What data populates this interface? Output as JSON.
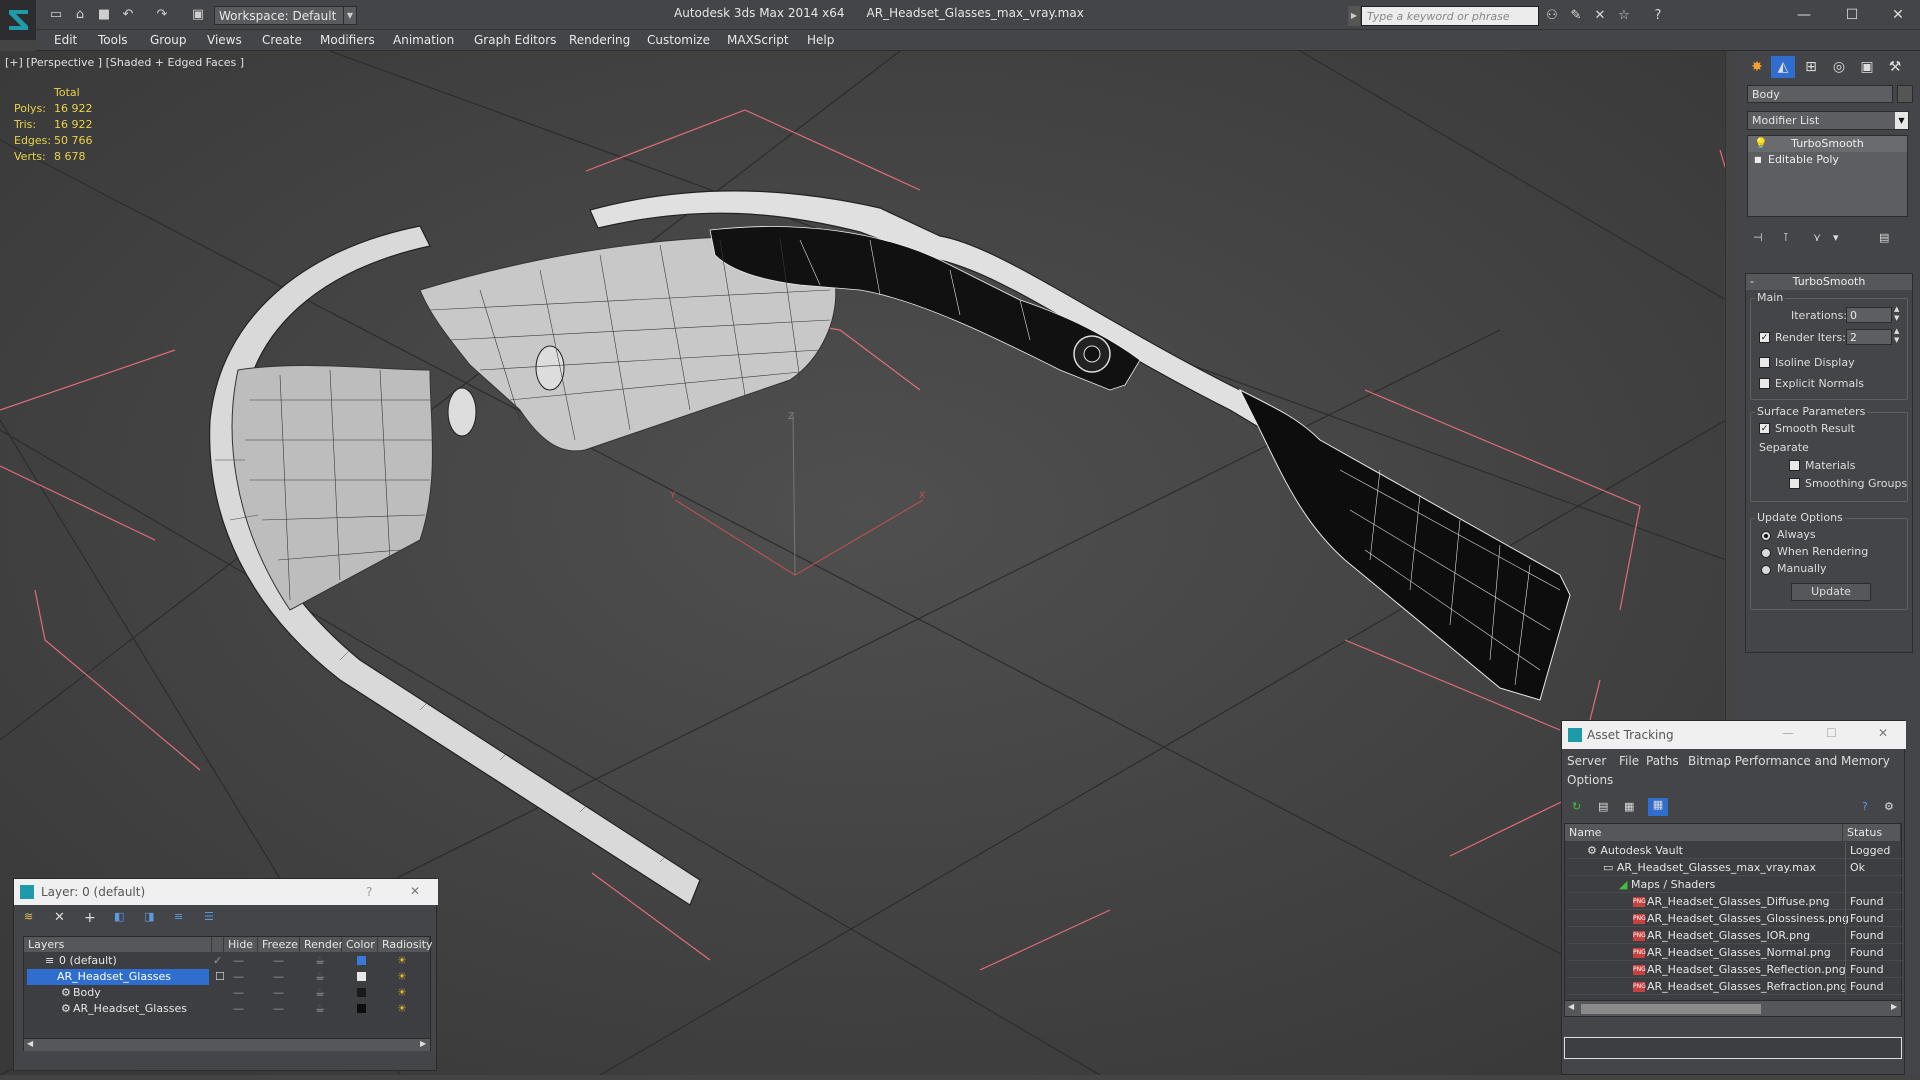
{
  "app": {
    "title": "Autodesk 3ds Max 2014 x64",
    "file": "AR_Headset_Glasses_max_vray.max",
    "workspace": "Workspace: Default",
    "search_placeholder": "Type a keyword or phrase"
  },
  "menu": [
    "Edit",
    "Tools",
    "Group",
    "Views",
    "Create",
    "Modifiers",
    "Animation",
    "Graph Editors",
    "Rendering",
    "Customize",
    "MAXScript",
    "Help"
  ],
  "viewport": {
    "label": "[+] [Perspective ] [Shaded + Edged Faces ]",
    "stats": {
      "header": "Total",
      "polys_label": "Polys:",
      "polys": "16 922",
      "tris_label": "Tris:",
      "tris": "16 922",
      "edges_label": "Edges:",
      "edges": "50 766",
      "verts_label": "Verts:",
      "verts": "8 678"
    }
  },
  "command_panel": {
    "object_name": "Body",
    "modifier_list": "Modifier List",
    "stack": [
      "TurboSmooth",
      "Editable Poly"
    ],
    "rollout_title": "TurboSmooth",
    "main_group": "Main",
    "iterations_label": "Iterations:",
    "iterations": "0",
    "render_iters_label": "Render Iters:",
    "render_iters": "2",
    "isoline": "Isoline Display",
    "explicit_normals": "Explicit Normals",
    "surface_group": "Surface Parameters",
    "smooth_result": "Smooth Result",
    "separate": "Separate",
    "materials": "Materials",
    "smoothing_groups": "Smoothing Groups",
    "update_group": "Update Options",
    "always": "Always",
    "when_rendering": "When Rendering",
    "manually": "Manually",
    "update_button": "Update"
  },
  "layer_dialog": {
    "title": "Layer: 0 (default)",
    "help": "?",
    "columns": [
      "Layers",
      "Hide",
      "Freeze",
      "Render",
      "Color",
      "Radiosity"
    ],
    "rows": [
      {
        "name": "0 (default)",
        "color": "#3a78d6"
      },
      {
        "name": "AR_Headset_Glasses",
        "color": "#e8e8e8"
      },
      {
        "name": "Body",
        "color": "#1a1a1a"
      },
      {
        "name": "AR_Headset_Glasses",
        "color": "#0d0d0d"
      }
    ]
  },
  "asset_tracking": {
    "title": "Asset Tracking",
    "menu": [
      "Server",
      "File",
      "Paths",
      "Bitmap Performance and Memory",
      "Options"
    ],
    "columns": [
      "Name",
      "Status"
    ],
    "rows": [
      {
        "name": "Autodesk Vault",
        "status": "Logged O"
      },
      {
        "name": "AR_Headset_Glasses_max_vray.max",
        "status": "Ok"
      },
      {
        "name": "Maps / Shaders",
        "status": ""
      },
      {
        "name": "AR_Headset_Glasses_Diffuse.png",
        "status": "Found"
      },
      {
        "name": "AR_Headset_Glasses_Glossiness.png",
        "status": "Found"
      },
      {
        "name": "AR_Headset_Glasses_IOR.png",
        "status": "Found"
      },
      {
        "name": "AR_Headset_Glasses_Normal.png",
        "status": "Found"
      },
      {
        "name": "AR_Headset_Glasses_Reflection.png",
        "status": "Found"
      },
      {
        "name": "AR_Headset_Glasses_Refraction.png",
        "status": "Found"
      }
    ]
  }
}
